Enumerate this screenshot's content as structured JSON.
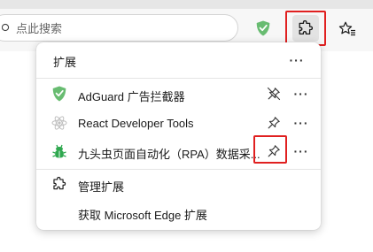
{
  "browser": {
    "search_placeholder": "点此搜索"
  },
  "menu": {
    "title": "扩展",
    "more_glyph": "···",
    "extensions": [
      {
        "name": "AdGuard 广告拦截器",
        "icon": "adguard-shield-icon",
        "pinned": false
      },
      {
        "name": "React Developer Tools",
        "icon": "react-atom-icon",
        "pinned": false
      },
      {
        "name": "九头虫页面自动化（RPA）数据采...",
        "icon": "bug-robot-icon",
        "pinned": false
      }
    ],
    "manage_label": "管理扩展",
    "get_label": "获取 Microsoft Edge 扩展"
  },
  "colors": {
    "highlight": "#e02020",
    "adguard_green": "#68bc71",
    "bug_green": "#2fa84f"
  }
}
